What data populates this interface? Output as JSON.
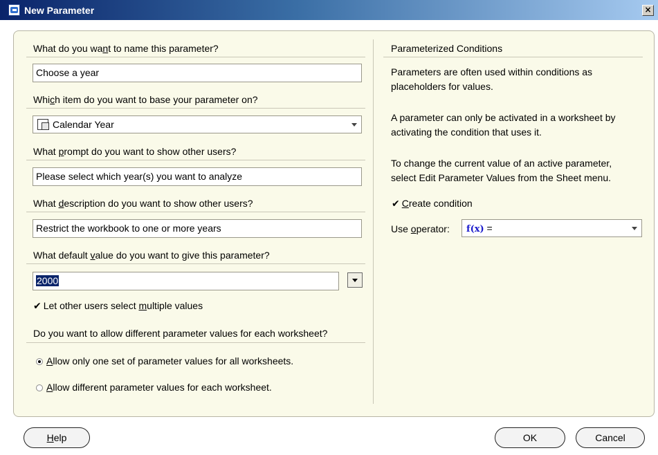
{
  "window": {
    "title": "New Parameter",
    "close_glyph": "×"
  },
  "left": {
    "name_question": {
      "before": "What do you wa",
      "accel": "n",
      "after": "t to name this parameter?"
    },
    "name_value": "Choose a year",
    "item_question": {
      "before": "Whi",
      "accel": "c",
      "after": "h item do you want to base your parameter on?"
    },
    "item_value": "Calendar Year",
    "prompt_question": {
      "before": "What ",
      "accel": "p",
      "after": "rompt do you want to show other users?"
    },
    "prompt_value": "Please select which year(s) you want to analyze",
    "desc_question": {
      "before": "What ",
      "accel": "d",
      "after": "escription do you want to show other users?"
    },
    "desc_value": "Restrict the workbook to one or more years",
    "default_question": {
      "before": "What default ",
      "accel": "v",
      "after": "alue do you want to give this parameter?"
    },
    "default_value": "2000",
    "multi_label": {
      "before": "Let other users select ",
      "accel": "m",
      "after": "ultiple values"
    },
    "multi_checked": true,
    "allow_question": "Do you want to allow different parameter values for each worksheet?",
    "radio_one": {
      "before": "",
      "accel": "A",
      "after": "llow only one set of parameter values for all worksheets."
    },
    "radio_two": {
      "before": "",
      "accel": "A",
      "after": "llow different parameter values for each worksheet."
    },
    "selected_radio": "one"
  },
  "right": {
    "heading": "Parameterized Conditions",
    "para1_line1": "Parameters are often used within conditions as",
    "para1_line2": "placeholders for values.",
    "para2_line1": "A parameter can only be activated in a worksheet by",
    "para2_line2": "activating the condition that uses it.",
    "para3_line1": "To change the current value of an active parameter,",
    "para3_line2": "select Edit Parameter Values from the Sheet menu.",
    "create_condition": {
      "before": "",
      "accel": "C",
      "after": "reate condition"
    },
    "create_checked": true,
    "operator_label": {
      "before": "Use ",
      "accel": "o",
      "after": "perator:"
    },
    "operator_fx": "f(x)",
    "operator_value": "="
  },
  "buttons": {
    "help": {
      "before": "",
      "accel": "H",
      "after": "elp"
    },
    "ok": "OK",
    "cancel": "Cancel"
  },
  "icons": {
    "app": "new-parameter-icon",
    "field": "field-item-icon",
    "check": "✔"
  }
}
